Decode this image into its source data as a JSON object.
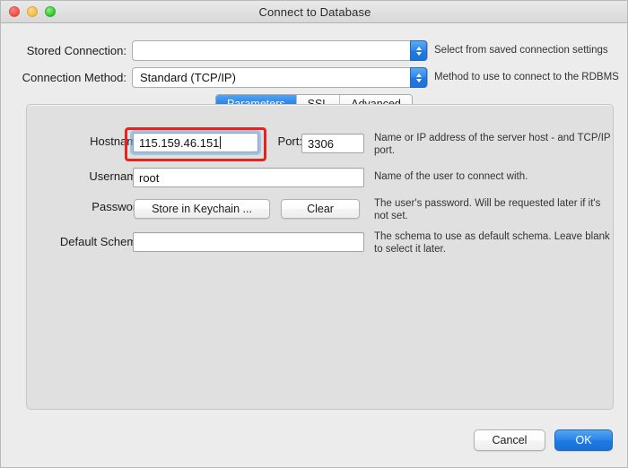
{
  "window": {
    "title": "Connect to Database",
    "traffic_lights": [
      "close-button",
      "minimize-button",
      "zoom-button"
    ]
  },
  "top_form": {
    "stored_connection": {
      "label": "Stored Connection:",
      "value": "",
      "hint": "Select from saved connection settings"
    },
    "connection_method": {
      "label": "Connection Method:",
      "value": "Standard (TCP/IP)",
      "hint": "Method to use to connect to the RDBMS"
    }
  },
  "tabs": [
    {
      "label": "Parameters",
      "active": true
    },
    {
      "label": "SSL",
      "active": false
    },
    {
      "label": "Advanced",
      "active": false
    }
  ],
  "parameters": {
    "hostname": {
      "label": "Hostname:",
      "value": "115.159.46.151",
      "focused": true,
      "annotated": true
    },
    "port": {
      "label": "Port:",
      "value": "3306"
    },
    "host_hint": "Name or IP address of the server host - and TCP/IP port.",
    "username": {
      "label": "Username:",
      "value": "root",
      "hint": "Name of the user to connect with."
    },
    "password": {
      "label": "Password:",
      "store_button": "Store in Keychain ...",
      "clear_button": "Clear",
      "hint": "The user's password. Will be requested later if it's not set."
    },
    "default_schema": {
      "label": "Default Schema:",
      "value": "",
      "hint": "The schema to use as default schema. Leave blank to select it later."
    }
  },
  "footer": {
    "cancel_label": "Cancel",
    "ok_label": "OK"
  },
  "colors": {
    "accent_blue": "#2b85ea",
    "annotation_red": "#e52421",
    "window_bg": "#ececec",
    "panel_bg": "#e0e0e0"
  }
}
